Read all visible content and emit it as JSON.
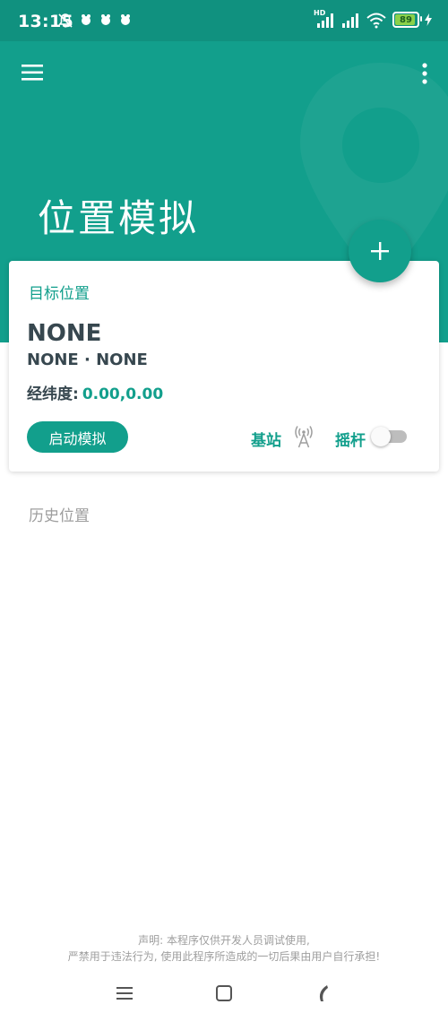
{
  "status_bar": {
    "time": "13:15",
    "signal_label": "HD",
    "battery_level": "89"
  },
  "header": {
    "title": "位置模拟",
    "color": "#129f8c"
  },
  "card": {
    "title": "目标位置",
    "location_name": "NONE",
    "location_detail": "NONE · NONE",
    "coord_label": "经纬度:",
    "coord_value": "0.00,0.00",
    "start_button_label": "启动模拟",
    "base_station_label": "基站",
    "joystick_label": "摇杆",
    "joystick_enabled": false
  },
  "history": {
    "title": "历史位置"
  },
  "disclaimer": {
    "line1": "声明: 本程序仅供开发人员调试使用,",
    "line2": "严禁用于违法行为, 使用此程序所造成的一切后果由用户自行承担!"
  },
  "icons": {
    "menu": "hamburger-menu-icon",
    "more": "more-vertical-icon",
    "add": "plus-icon",
    "antenna": "antenna-icon"
  }
}
